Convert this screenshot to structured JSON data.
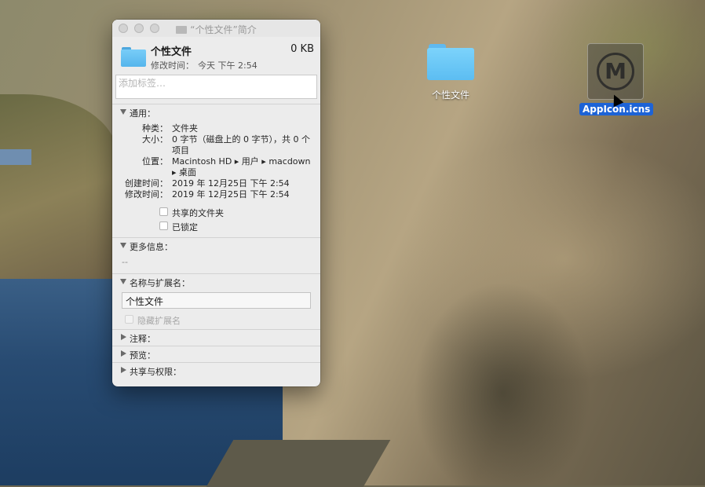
{
  "desktop": {
    "folder_label": "个性文件",
    "icns_label": "AppIcon.icns",
    "icns_glyph": "M"
  },
  "window": {
    "title": "“个性文件”简介",
    "name": "个性文件",
    "size": "0 KB",
    "modified_label": "修改时间：",
    "modified_value": "今天 下午 2:54",
    "tag_placeholder": "添加标签…",
    "general": {
      "title": "通用：",
      "kind_label": "种类：",
      "kind_value": "文件夹",
      "size_label": "大小：",
      "size_value_line1": "0 字节（磁盘上的 0 字节），共 0 个",
      "size_value_line2": "项目",
      "where_label": "位置：",
      "where_value_line1": "Macintosh HD ▸ 用户 ▸ macdown",
      "where_value_line2": "▸ 桌面",
      "created_label": "创建时间：",
      "created_value": "2019 年 12月25日 下午 2:54",
      "modified_label": "修改时间：",
      "modified_value": "2019 年 12月25日 下午 2:54",
      "shared_folder": "共享的文件夹",
      "locked": "已锁定"
    },
    "more_info": {
      "title": "更多信息：",
      "value": "--"
    },
    "name_ext": {
      "title": "名称与扩展名：",
      "value": "个性文件",
      "hide_ext": "隐藏扩展名"
    },
    "comments_title": "注释：",
    "preview_title": "预览：",
    "sharing_title": "共享与权限："
  }
}
